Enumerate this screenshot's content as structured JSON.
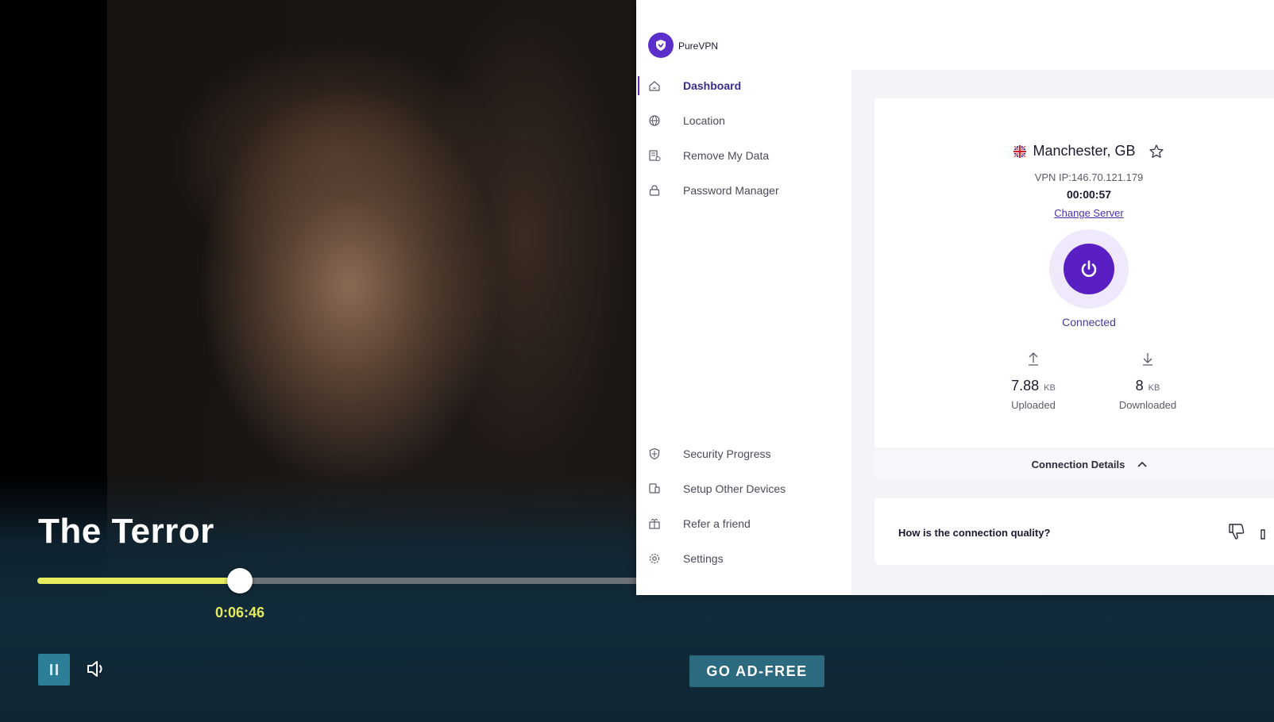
{
  "player": {
    "title": "The Terror",
    "current_time": "0:06:46",
    "progress_fraction": 0.335,
    "ad_free_label": "GO AD-FREE",
    "colors": {
      "accent": "#e4eb5c",
      "button_bg": "#2d7f97"
    }
  },
  "vpn": {
    "brand": "PureVPN",
    "nav_top": [
      {
        "label": "Dashboard",
        "icon": "home-icon",
        "active": true
      },
      {
        "label": "Location",
        "icon": "globe-icon",
        "active": false
      },
      {
        "label": "Remove My Data",
        "icon": "data-removal-icon",
        "active": false
      },
      {
        "label": "Password Manager",
        "icon": "lock-icon",
        "active": false
      }
    ],
    "nav_bottom": [
      {
        "label": "Security Progress",
        "icon": "shield-icon"
      },
      {
        "label": "Setup Other Devices",
        "icon": "devices-icon"
      },
      {
        "label": "Refer a friend",
        "icon": "gift-icon"
      },
      {
        "label": "Settings",
        "icon": "gear-icon"
      }
    ],
    "location": "Manchester, GB",
    "vpn_ip": "VPN IP:146.70.121.179",
    "timer": "00:00:57",
    "change_server": "Change Server",
    "status": "Connected",
    "upload": {
      "value": "7.88",
      "unit": "KB",
      "label": "Uploaded"
    },
    "download": {
      "value": "8",
      "unit": "KB",
      "label": "Downloaded"
    },
    "connection_details": "Connection Details",
    "quality_question": "How is the connection quality?",
    "colors": {
      "brand": "#5a1fc2",
      "background": "#f3f4f7"
    }
  }
}
